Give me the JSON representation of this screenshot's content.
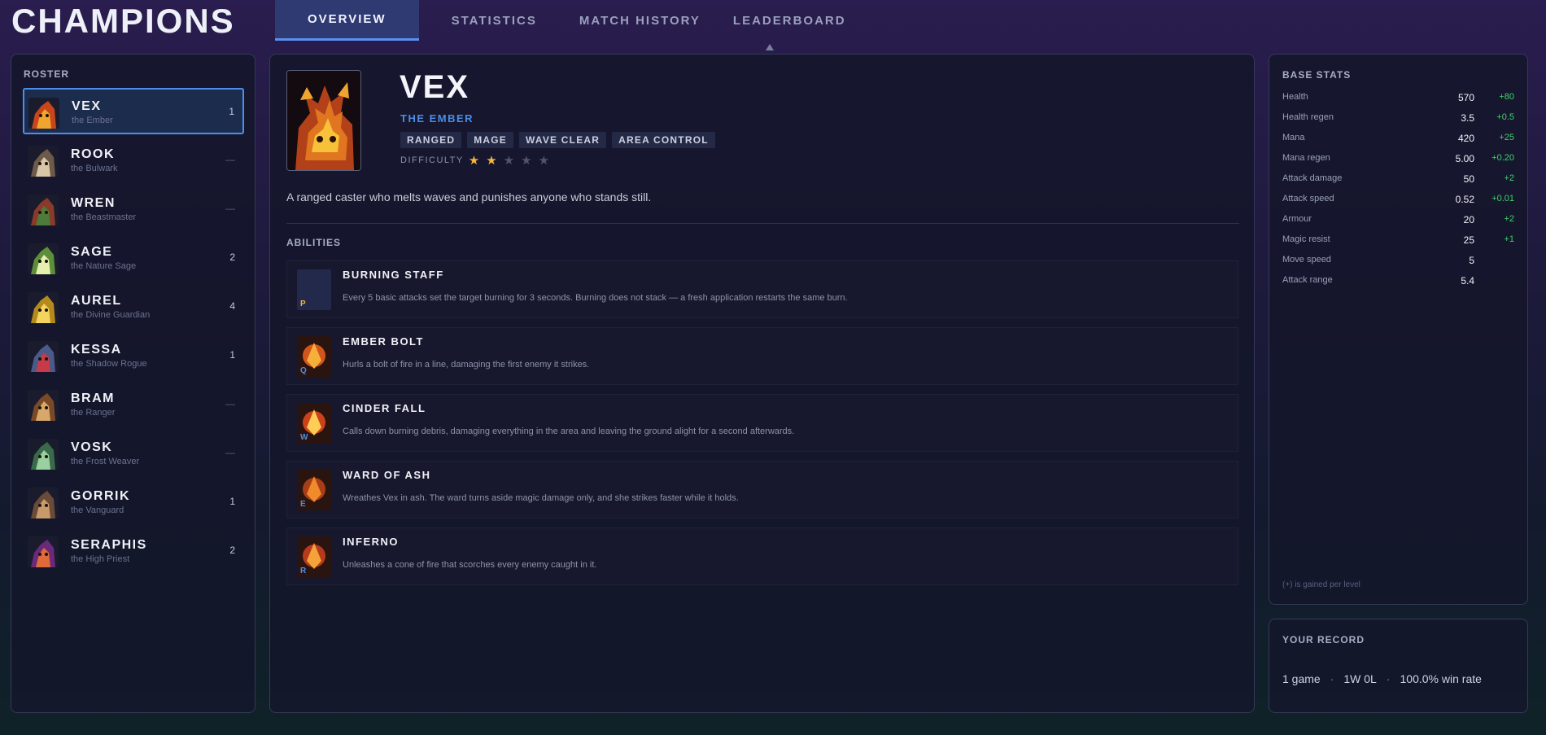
{
  "app": {
    "title": "CHAMPIONS"
  },
  "tabs": [
    {
      "label": "OVERVIEW",
      "active": true
    },
    {
      "label": "STATISTICS",
      "active": false
    },
    {
      "label": "MATCH HISTORY",
      "active": false
    },
    {
      "label": "LEADERBOARD",
      "active": false
    }
  ],
  "roster": {
    "heading": "ROSTER",
    "items": [
      {
        "name": "VEX",
        "title": "the Ember",
        "count": "1",
        "selected": true
      },
      {
        "name": "ROOK",
        "title": "the Bulwark",
        "count": "—"
      },
      {
        "name": "WREN",
        "title": "the Beastmaster",
        "count": "—"
      },
      {
        "name": "SAGE",
        "title": "the Nature Sage",
        "count": "2"
      },
      {
        "name": "AUREL",
        "title": "the Divine Guardian",
        "count": "4"
      },
      {
        "name": "KESSA",
        "title": "the Shadow Rogue",
        "count": "1"
      },
      {
        "name": "BRAM",
        "title": "the Ranger",
        "count": "—"
      },
      {
        "name": "VOSK",
        "title": "the Frost Weaver",
        "count": "—"
      },
      {
        "name": "GORRIK",
        "title": "the Vanguard",
        "count": "1"
      },
      {
        "name": "SERAPHIS",
        "title": "the High Priest",
        "count": "2"
      }
    ]
  },
  "champion": {
    "name": "VEX",
    "title": "THE EMBER",
    "tags": [
      "RANGED",
      "MAGE",
      "WAVE CLEAR",
      "AREA CONTROL"
    ],
    "difficulty_label": "DIFFICULTY",
    "difficulty": 2,
    "difficulty_max": 5,
    "blurb": "A ranged caster who melts waves and punishes anyone who stands still.",
    "abilities_heading": "ABILITIES",
    "abilities": [
      {
        "key": "P",
        "name": "BURNING STAFF",
        "desc": "Every 5 basic attacks set the target burning for 3 seconds. Burning does not stack — a fresh application restarts the same burn."
      },
      {
        "key": "Q",
        "name": "EMBER BOLT",
        "desc": "Hurls a bolt of fire in a line, damaging the first enemy it strikes."
      },
      {
        "key": "W",
        "name": "CINDER FALL",
        "desc": "Calls down burning debris, damaging everything in the area and leaving the ground alight for a second afterwards."
      },
      {
        "key": "E",
        "name": "WARD OF ASH",
        "desc": "Wreathes Vex in ash. The ward turns aside magic damage only, and she strikes faster while it holds."
      },
      {
        "key": "R",
        "name": "INFERNO",
        "desc": "Unleashes a cone of fire that scorches every enemy caught in it."
      }
    ]
  },
  "base_stats": {
    "heading": "BASE STATS",
    "rows": [
      {
        "label": "Health",
        "value": "570",
        "gain": "+80"
      },
      {
        "label": "Health regen",
        "value": "3.5",
        "gain": "+0.5"
      },
      {
        "label": "Mana",
        "value": "420",
        "gain": "+25"
      },
      {
        "label": "Mana regen",
        "value": "5.00",
        "gain": "+0.20"
      },
      {
        "label": "Attack damage",
        "value": "50",
        "gain": "+2"
      },
      {
        "label": "Attack speed",
        "value": "0.52",
        "gain": "+0.01"
      },
      {
        "label": "Armour",
        "value": "20",
        "gain": "+2"
      },
      {
        "label": "Magic resist",
        "value": "25",
        "gain": "+1"
      },
      {
        "label": "Move speed",
        "value": "5",
        "gain": ""
      },
      {
        "label": "Attack range",
        "value": "5.4",
        "gain": ""
      }
    ],
    "note": "(+) is gained per level"
  },
  "record": {
    "heading": "YOUR RECORD",
    "games": "1 game",
    "wl": "1W 0L",
    "winrate": "100.0% win rate",
    "separator": "·"
  },
  "colors": {
    "accent": "#4e8eea",
    "gain": "#3ed26a",
    "star": "#f4b63c"
  }
}
